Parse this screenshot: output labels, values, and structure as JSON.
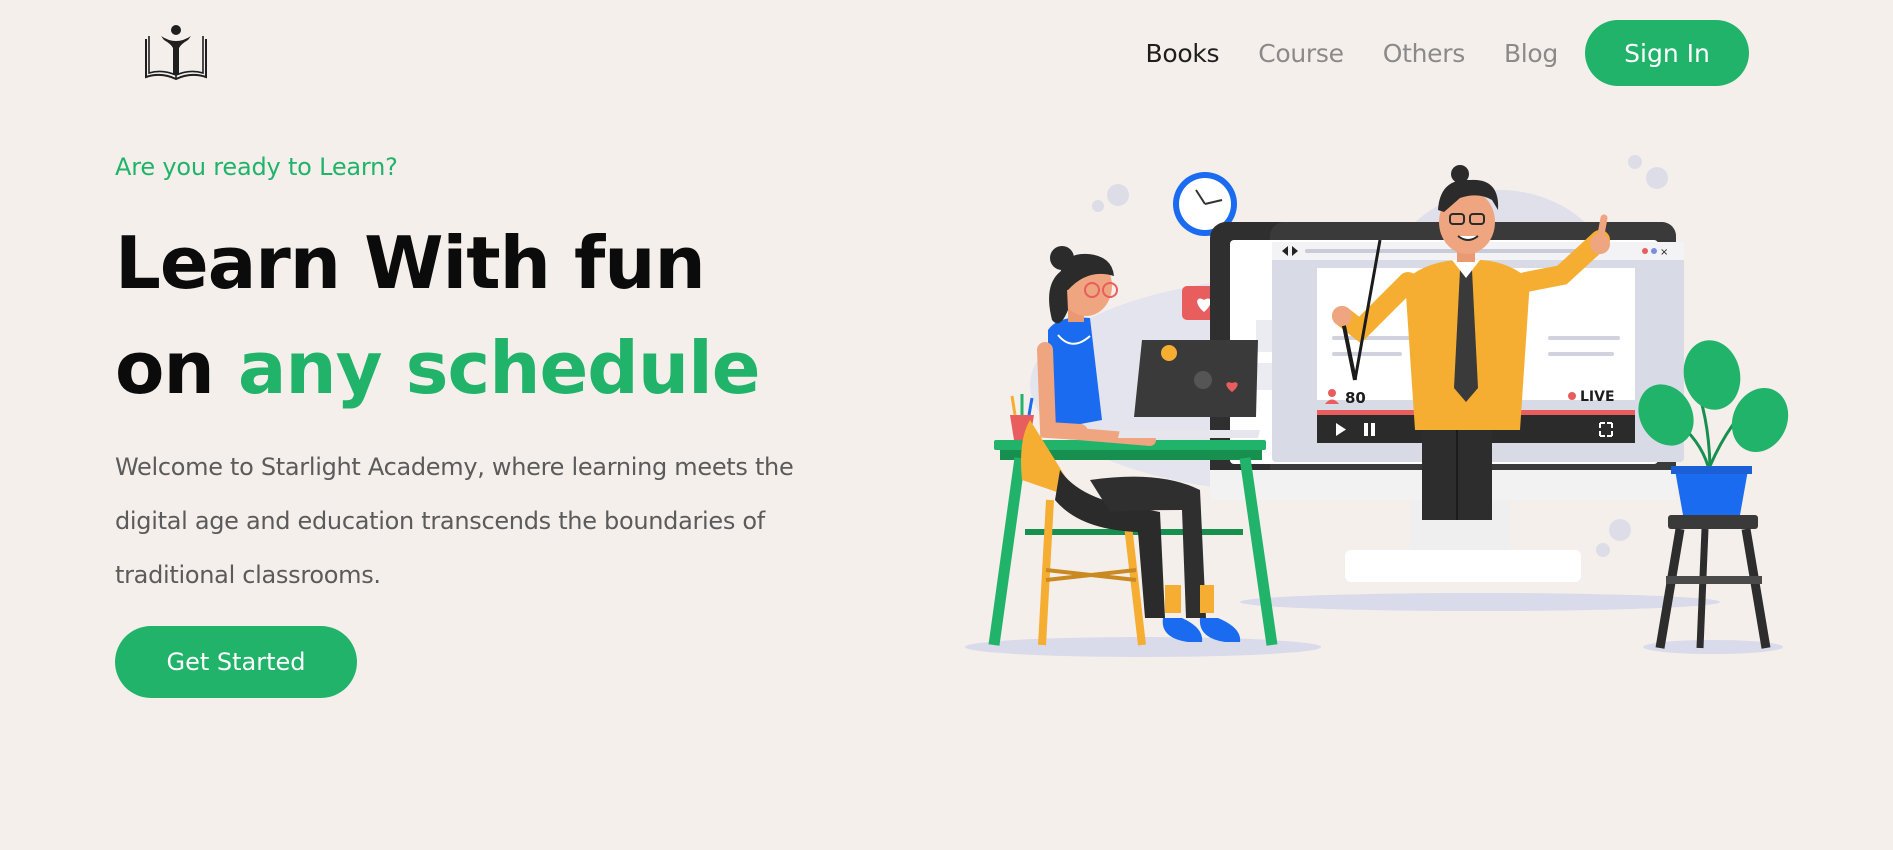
{
  "brand": {
    "logo_icon": "open-book-reader-icon"
  },
  "nav": {
    "items": [
      {
        "label": "Books",
        "active": true
      },
      {
        "label": "Course",
        "active": false
      },
      {
        "label": "Others",
        "active": false
      },
      {
        "label": "Blog",
        "active": false
      }
    ],
    "signin_label": "Sign In"
  },
  "hero": {
    "eyebrow": "Are you ready to Learn?",
    "headline_line1": "Learn With fun",
    "headline_line2_prefix": "on",
    "headline_line2_accent": "any schedule",
    "description": "Welcome to Starlight Academy, where learning meets the digital age and education transcends the boundaries of traditional classrooms.",
    "cta_label": "Get Started"
  },
  "illustration": {
    "viewer_count": "80",
    "live_label": "LIVE"
  },
  "colors": {
    "background": "#f5efec",
    "accent": "#21b36a",
    "heading": "#0b0b0b",
    "body_text": "#5b5b5b",
    "nav_muted": "#8a8a8a"
  }
}
